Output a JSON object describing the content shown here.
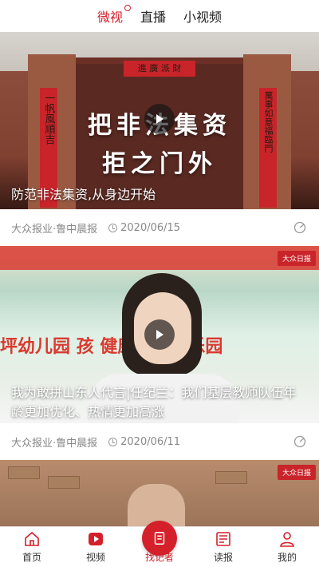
{
  "header": {
    "tabs": [
      {
        "label": "微视",
        "active": true
      },
      {
        "label": "直播",
        "active": false
      },
      {
        "label": "小视频",
        "active": false
      }
    ]
  },
  "feed": [
    {
      "image_text_line1": "把非法集资",
      "image_text_line2": "拒之门外",
      "door_lintel": "進 廣 派 財",
      "couplet_left": "一帆風順吉",
      "couplet_right": "萬事如意福臨門",
      "caption": "防范非法集资,从身边开始",
      "source": "大众报业·鲁中晨报",
      "date": "2020/06/15"
    },
    {
      "sign_text": "坪幼儿园  孩   健康成长的乐园",
      "logo": "大众日报",
      "caption": "我为敢拼山东人代言|任纪兰：我们基层教师队伍年龄更加优化、热情更加高涨",
      "source": "大众报业·鲁中晨报",
      "date": "2020/06/11"
    },
    {
      "logo": "大众日报"
    }
  ],
  "tabbar": {
    "items": [
      {
        "label": "首页",
        "icon": "home-icon"
      },
      {
        "label": "视频",
        "icon": "video-icon"
      },
      {
        "label": "找记者",
        "icon": "reporter-icon"
      },
      {
        "label": "读报",
        "icon": "newspaper-icon"
      },
      {
        "label": "我的",
        "icon": "profile-icon"
      }
    ]
  },
  "colors": {
    "accent": "#d4202a"
  }
}
